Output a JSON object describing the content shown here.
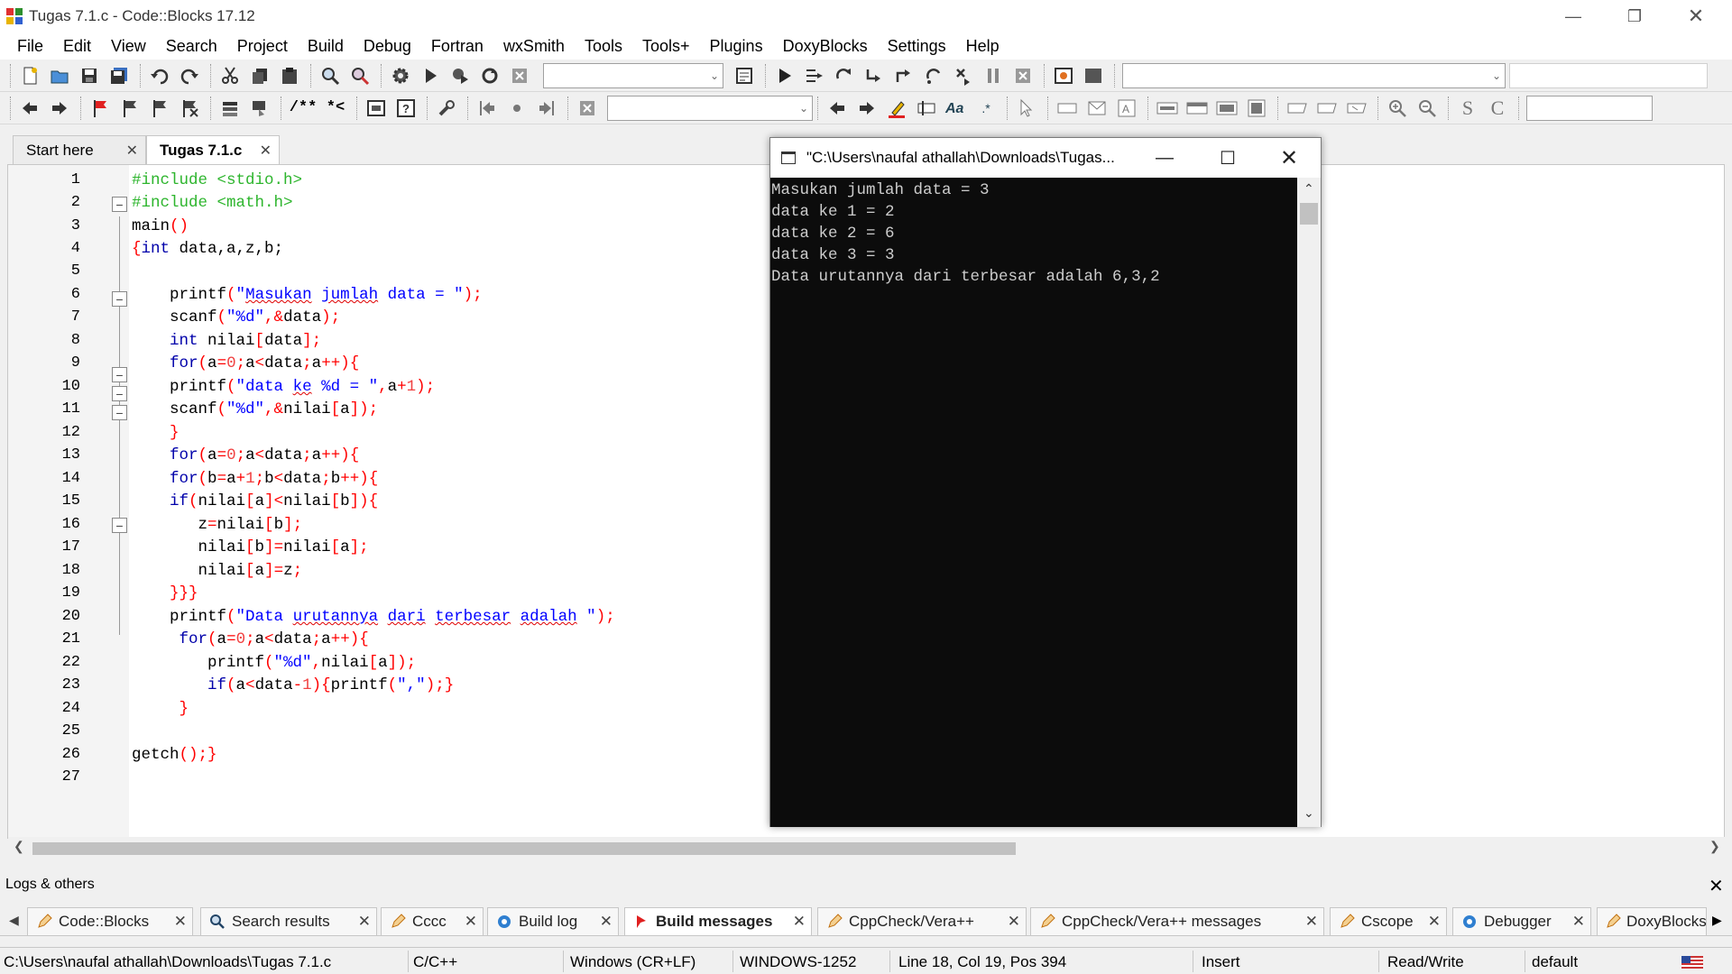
{
  "window": {
    "title": "Tugas 7.1.c - Code::Blocks 17.12"
  },
  "menu": [
    "File",
    "Edit",
    "View",
    "Search",
    "Project",
    "Build",
    "Debug",
    "Fortran",
    "wxSmith",
    "Tools",
    "Tools+",
    "Plugins",
    "DoxyBlocks",
    "Settings",
    "Help"
  ],
  "toolbar": {
    "comment_label": "/**",
    "uncomment_label": "*<",
    "regex_label": ".*",
    "strikeout_label": "S",
    "copyright_label": "C"
  },
  "editor_tabs": [
    {
      "label": "Start here",
      "active": false
    },
    {
      "label": "Tugas 7.1.c",
      "active": true
    }
  ],
  "code_lines": [
    "1",
    "2",
    "3",
    "4",
    "5",
    "6",
    "7",
    "8",
    "9",
    "10",
    "11",
    "12",
    "13",
    "14",
    "15",
    "16",
    "17",
    "18",
    "19",
    "20",
    "21",
    "22",
    "23",
    "24",
    "25",
    "26",
    "27"
  ],
  "code": {
    "l1": "#include <stdio.h>",
    "l2": "#include <math.h>",
    "l3a": "main",
    "l3b": "()",
    "l4a": "{",
    "l4b": "int",
    "l4c": " data,a,z,b;",
    "l6a": "    printf",
    "l6b": "(",
    "l6c": "\"",
    "l6d": "Masukan",
    "l6e": " ",
    "l6f": "jumlah",
    "l6g": " data = \"",
    "l6h": ");",
    "l7a": "    scanf",
    "l7b": "(",
    "l7c": "\"%d\"",
    "l7d": ",&",
    "l7e": "data",
    "l7f": ");",
    "l8a": "    ",
    "l8b": "int",
    "l8c": " nilai",
    "l8d": "[",
    "l8e": "data",
    "l8f": "];",
    "l9a": "    ",
    "l9b": "for",
    "l9c": "(",
    "l9d": "a",
    "l9e": "=",
    "l9f": "0",
    "l9g": ";",
    "l9h": "a",
    "l9i": "<",
    "l9j": "data",
    "l9k": ";",
    "l9l": "a",
    "l9m": "++){",
    "l10a": "    printf",
    "l10b": "(",
    "l10c": "\"data ",
    "l10d": "ke",
    "l10e": " %d = \"",
    "l10f": ",",
    "l10g": "a",
    "l10h": "+",
    "l10i": "1",
    "l10j": ");",
    "l11a": "    scanf",
    "l11b": "(",
    "l11c": "\"%d\"",
    "l11d": ",&",
    "l11e": "nilai",
    "l11f": "[",
    "l11g": "a",
    "l11h": "]);",
    "l12": "    }",
    "l13a": "    ",
    "l13b": "for",
    "l13c": "(",
    "l13d": "a",
    "l13e": "=",
    "l13f": "0",
    "l13g": ";",
    "l13h": "a",
    "l13i": "<",
    "l13j": "data",
    "l13k": ";",
    "l13l": "a",
    "l13m": "++){",
    "l14a": "    ",
    "l14b": "for",
    "l14c": "(",
    "l14d": "b",
    "l14e": "=",
    "l14f": "a",
    "l14g": "+",
    "l14h": "1",
    "l14i": ";",
    "l14j": "b",
    "l14k": "<",
    "l14l": "data",
    "l14m": ";",
    "l14n": "b",
    "l14o": "++){",
    "l15a": "    ",
    "l15b": "if",
    "l15c": "(",
    "l15d": "nilai",
    "l15e": "[",
    "l15f": "a",
    "l15g": "]<",
    "l15h": "nilai",
    "l15i": "[",
    "l15j": "b",
    "l15k": "]){",
    "l16a": "       z",
    "l16b": "=",
    "l16c": "nilai",
    "l16d": "[",
    "l16e": "b",
    "l16f": "];",
    "l17a": "       nilai",
    "l17b": "[",
    "l17c": "b",
    "l17d": "]=",
    "l17e": "nilai",
    "l17f": "[",
    "l17g": "a",
    "l17h": "];",
    "l18a": "       nilai",
    "l18b": "[",
    "l18c": "a",
    "l18d": "]=",
    "l18e": "z",
    "l18f": ";",
    "l19": "    }}}",
    "l20a": "    printf",
    "l20b": "(",
    "l20c": "\"Data ",
    "l20d": "urutannya",
    "l20e": " ",
    "l20f": "dari",
    "l20g": " ",
    "l20h": "terbesar",
    "l20i": " ",
    "l20j": "adalah",
    "l20k": " \"",
    "l20l": ");",
    "l21a": "     ",
    "l21b": "for",
    "l21c": "(",
    "l21d": "a",
    "l21e": "=",
    "l21f": "0",
    "l21g": ";",
    "l21h": "a",
    "l21i": "<",
    "l21j": "data",
    "l21k": ";",
    "l21l": "a",
    "l21m": "++){",
    "l22a": "        printf",
    "l22b": "(",
    "l22c": "\"%d\"",
    "l22d": ",",
    "l22e": "nilai",
    "l22f": "[",
    "l22g": "a",
    "l22h": "]);",
    "l23a": "        ",
    "l23b": "if",
    "l23c": "(",
    "l23d": "a",
    "l23e": "<",
    "l23f": "data",
    "l23g": "-",
    "l23h": "1",
    "l23i": "){",
    "l23j": "printf",
    "l23k": "(",
    "l23l": "\",\"",
    "l23m": ");}",
    "l24": "     }",
    "l26a": "getch",
    "l26b": "();}"
  },
  "console": {
    "title": "\"C:\\Users\\naufal athallah\\Downloads\\Tugas...",
    "lines": [
      "Masukan jumlah data = 3",
      "data ke 1 = 2",
      "data ke 2 = 6",
      "data ke 3 = 3",
      "Data urutannya dari terbesar adalah 6,3,2"
    ]
  },
  "logs": {
    "header": "Logs & others",
    "tabs": [
      {
        "label": "Code::Blocks",
        "icon": "pencil-icon"
      },
      {
        "label": "Search results",
        "icon": "search-icon"
      },
      {
        "label": "Cccc",
        "icon": "pencil-icon"
      },
      {
        "label": "Build log",
        "icon": "gear-icon"
      },
      {
        "label": "Build messages",
        "icon": "pin-icon",
        "active": true
      },
      {
        "label": "CppCheck/Vera++",
        "icon": "pencil-icon"
      },
      {
        "label": "CppCheck/Vera++ messages",
        "icon": "pencil-icon"
      },
      {
        "label": "Cscope",
        "icon": "pencil-icon"
      },
      {
        "label": "Debugger",
        "icon": "gear-icon"
      },
      {
        "label": "DoxyBlocks",
        "icon": "pencil-icon"
      }
    ]
  },
  "status": {
    "path": "C:\\Users\\naufal athallah\\Downloads\\Tugas 7.1.c",
    "language": "C/C++",
    "eol": "Windows (CR+LF)",
    "encoding": "WINDOWS-1252",
    "position": "Line 18, Col 19, Pos 394",
    "mode": "Insert",
    "access": "Read/Write",
    "profile": "default"
  },
  "colors": {
    "preprocessor": "#2db52d",
    "keyword": "#0000aa",
    "string": "#0000ff",
    "operator": "#ff0000",
    "console_bg": "#0c0c0c",
    "console_fg": "#cccccc"
  }
}
